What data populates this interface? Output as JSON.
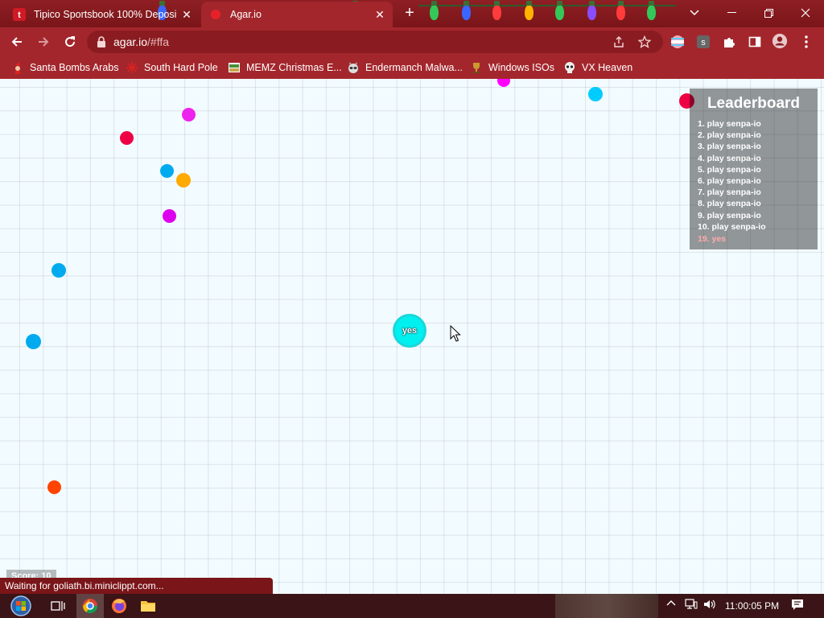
{
  "browser": {
    "tabs": [
      {
        "title": "Tipico Sportsbook 100% Deposi",
        "favicon": "tipico-icon",
        "active": false
      },
      {
        "title": "Agar.io",
        "favicon": "agar-icon",
        "active": true
      }
    ],
    "new_tab_label": "+",
    "close_glyph": "✕",
    "url_host": "agar.io",
    "url_path": "/#ffa",
    "accent": "#a3262c",
    "tabstrip_color": "#8e1f24"
  },
  "bookmarks": [
    {
      "label": "Santa Bombs Arabs",
      "icon": "santa-icon"
    },
    {
      "label": "South Hard Pole",
      "icon": "snowflake-icon"
    },
    {
      "label": "MEMZ Christmas E...",
      "icon": "memz-icon"
    },
    {
      "label": "Endermanch Malwa...",
      "icon": "raccoon-icon"
    },
    {
      "label": "Windows ISOs",
      "icon": "trophy-icon"
    },
    {
      "label": "VX Heaven",
      "icon": "skull-icon"
    }
  ],
  "game": {
    "background": "#f2fbff",
    "player": {
      "name": "yes",
      "color": "#00f0f0"
    },
    "pellet_colors": [
      "#ff00ff",
      "#00ccff",
      "#ee0044",
      "#ffaa00",
      "#00aaee",
      "#ff4400"
    ],
    "leaderboard": {
      "title": "Leaderboard",
      "entries": [
        "1. play senpa-io",
        "2. play senpa-io",
        "3. play senpa-io",
        "4. play senpa-io",
        "5. play senpa-io",
        "6. play senpa-io",
        "7. play senpa-io",
        "8. play senpa-io",
        "9. play senpa-io",
        "10. play senpa-io"
      ],
      "own_entry": "19. yes"
    },
    "score_label": "Score: 10"
  },
  "status_text": "Waiting for goliath.bi.miniclippt.com...",
  "taskbar": {
    "apps": [
      "start-orb-icon",
      "task-view-icon",
      "chrome-icon",
      "firefox-icon",
      "file-explorer-icon"
    ],
    "clock": "11:00:05 PM"
  }
}
